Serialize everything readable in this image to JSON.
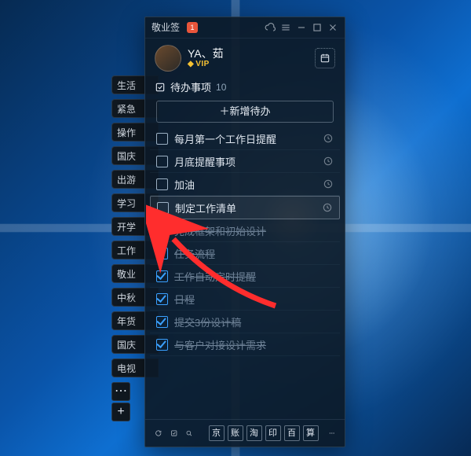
{
  "titlebar": {
    "app_name": "敬业签",
    "notif_count": "1"
  },
  "user": {
    "name": "YA、茹",
    "vip": "VIP"
  },
  "section": {
    "title": "待办事项",
    "count": "10"
  },
  "add_button": {
    "label": "＋新增待办"
  },
  "todos": [
    {
      "label": "每月第一个工作日提醒",
      "done": false,
      "clock": true,
      "selected": false
    },
    {
      "label": "月底提醒事项",
      "done": false,
      "clock": true,
      "selected": false
    },
    {
      "label": "加油",
      "done": false,
      "clock": true,
      "selected": false
    },
    {
      "label": "制定工作清单",
      "done": false,
      "clock": true,
      "selected": true
    },
    {
      "label": "完成框架和初始设计",
      "done": true,
      "clock": false,
      "selected": false
    },
    {
      "label": "任务流程",
      "done": true,
      "clock": false,
      "selected": false
    },
    {
      "label": "工作自动定时提醒",
      "done": true,
      "clock": false,
      "selected": false
    },
    {
      "label": "日程",
      "done": true,
      "clock": false,
      "selected": false
    },
    {
      "label": "提交3份设计稿",
      "done": true,
      "clock": false,
      "selected": false
    },
    {
      "label": "与客户对接设计需求",
      "done": true,
      "clock": false,
      "selected": false
    }
  ],
  "side_tabs": [
    {
      "label": "生活"
    },
    {
      "label": "紧急"
    },
    {
      "label": "操作"
    },
    {
      "label": "国庆"
    },
    {
      "label": "出游"
    },
    {
      "label": "学习"
    },
    {
      "label": "开学"
    },
    {
      "label": "工作"
    },
    {
      "label": "敬业"
    },
    {
      "label": "中秋"
    },
    {
      "label": "年货"
    },
    {
      "label": "国庆"
    },
    {
      "label": "电视"
    }
  ],
  "bottom_squares": [
    {
      "label": "京"
    },
    {
      "label": "账"
    },
    {
      "label": "淘"
    },
    {
      "label": "印"
    },
    {
      "label": "百"
    },
    {
      "label": "算"
    }
  ]
}
